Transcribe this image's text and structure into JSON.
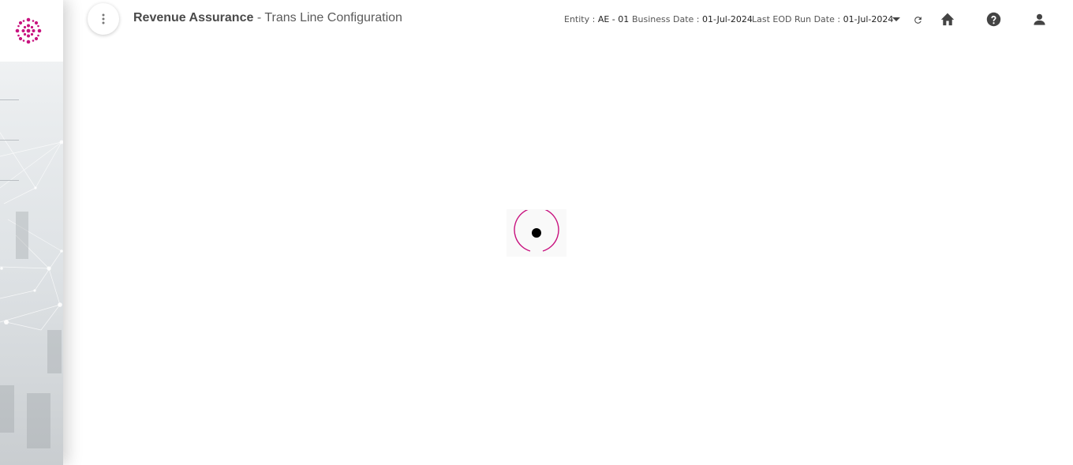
{
  "header": {
    "app_name": "Revenue Assurance",
    "separator": " - ",
    "page_title": "Trans Line Configuration",
    "entity_label": "Entity :",
    "entity_value": "AE - 01",
    "business_date_label": "Business Date :",
    "business_date_value": "01-Jul-2024",
    "eod_label": "Last EOD Run Date :",
    "eod_value": "01-Jul-2024"
  },
  "icons": {
    "menu": "more-vert-icon",
    "dropdown": "caret-down-icon",
    "refresh": "refresh-icon",
    "home": "home-icon",
    "help": "help-icon",
    "user": "user-icon",
    "logo": "brand-logo"
  },
  "colors": {
    "brand": "#c8127f",
    "icon": "#444444",
    "loader_ring": "#c8127f",
    "loader_dot": "#000000"
  },
  "loader": {
    "state": "loading"
  }
}
